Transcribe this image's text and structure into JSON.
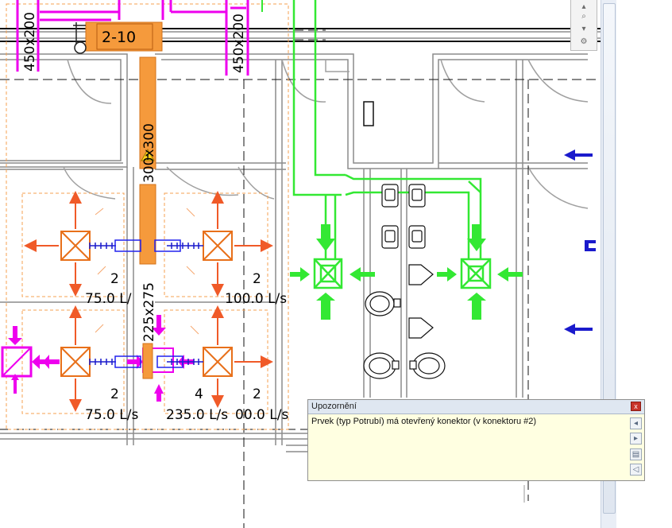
{
  "drawing": {
    "duct_tag_top_left": "450x200",
    "duct_tag_top_right": "450x200",
    "equipment_tag": "2-10",
    "duct_tag_main": "300x300",
    "duct_tag_lower": "225x275",
    "terminals": [
      {
        "count": "2",
        "flow": "75.0 L/"
      },
      {
        "count": "2",
        "flow": "100.0 L/s"
      },
      {
        "count": "2",
        "flow": "75.0 L/s"
      },
      {
        "count": "4",
        "flow": "235.0 L/s"
      },
      {
        "count": "2",
        "flow": "00.0 L/s"
      }
    ]
  },
  "warning_dialog": {
    "title": "Upozornění",
    "close_symbol": "x",
    "message": "Prvek (typ Potrubí) má otevřený konektor (v konektoru #2)"
  },
  "colors": {
    "exhaust_duct": "#f59a3c",
    "supply_duct": "#33e833",
    "transfer_duct": "#ee00ee",
    "warning_bg": "#ffffe1",
    "connector_arrow": "#1a1acc"
  },
  "icons": {
    "warning": "warning-triangle-icon",
    "nav_zoom": "zoom-icon",
    "dialog_prev": "arrow-left-icon",
    "dialog_next": "arrow-right-icon",
    "dialog_show": "show-element-icon",
    "dialog_sound": "speaker-icon"
  }
}
